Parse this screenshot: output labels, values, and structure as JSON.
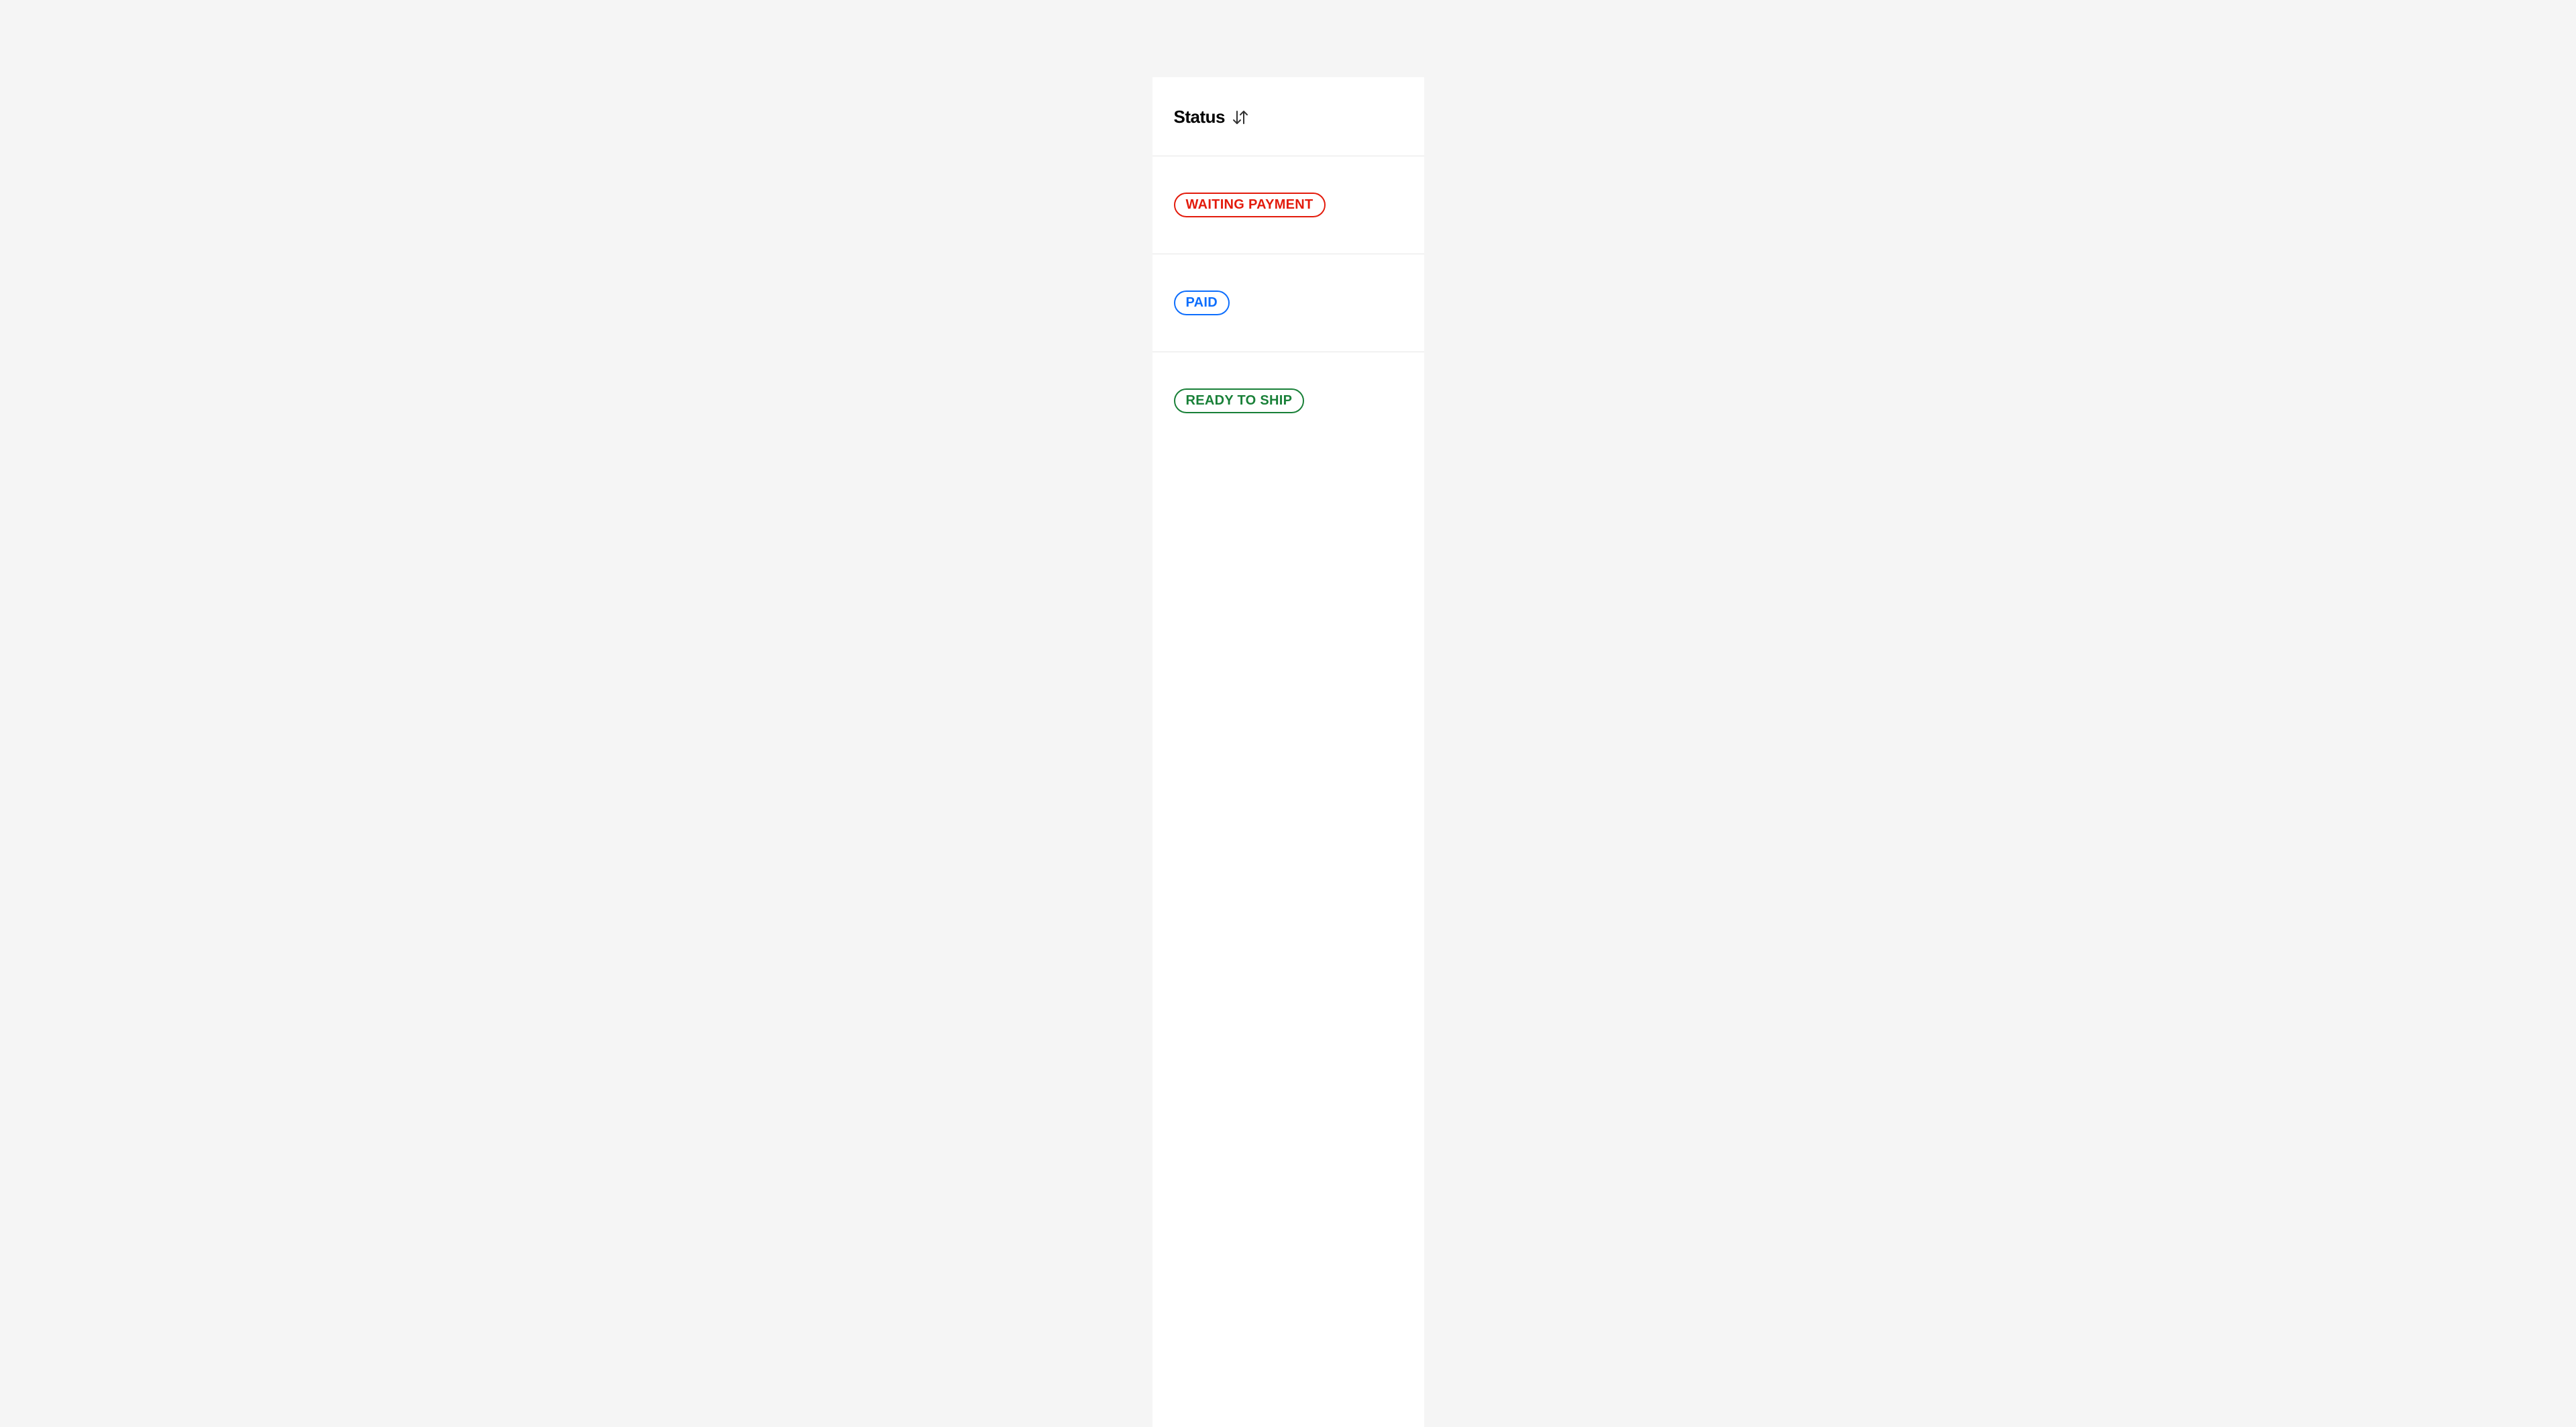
{
  "column": {
    "header": "Status"
  },
  "rows": [
    {
      "label": "WAITING PAYMENT",
      "variant": "red"
    },
    {
      "label": "PAID",
      "variant": "blue"
    },
    {
      "label": "READY TO SHIP",
      "variant": "green"
    }
  ]
}
